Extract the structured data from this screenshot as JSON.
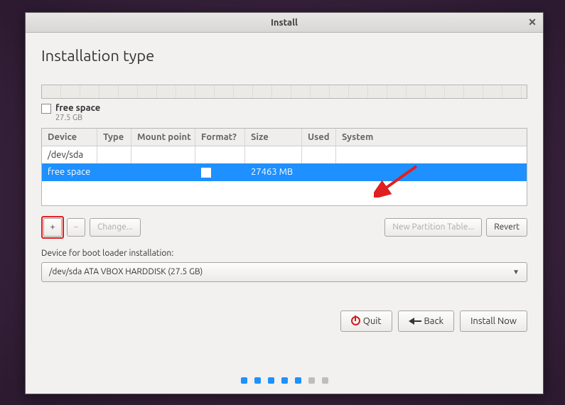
{
  "window": {
    "title": "Install"
  },
  "page": {
    "heading": "Installation type"
  },
  "summary": {
    "label": "free space",
    "size": "27.5 GB"
  },
  "table": {
    "headers": {
      "device": "Device",
      "type": "Type",
      "mount": "Mount point",
      "format": "Format?",
      "size": "Size",
      "used": "Used",
      "system": "System"
    },
    "rows": [
      {
        "device": "/dev/sda",
        "type": "",
        "mount": "",
        "format": "",
        "size": "",
        "used": "",
        "system": "",
        "selected": false,
        "parent": true
      },
      {
        "device": "  free space",
        "type": "",
        "mount": "",
        "format": "checkbox",
        "size": "27463 MB",
        "used": "",
        "system": "",
        "selected": true,
        "parent": false
      }
    ]
  },
  "toolbar": {
    "add": "+",
    "remove": "−",
    "change": "Change...",
    "newTable": "New Partition Table...",
    "revert": "Revert"
  },
  "boot": {
    "label": "Device for boot loader installation:",
    "value": "/dev/sda  ATA VBOX HARDDISK (27.5 GB)"
  },
  "footer": {
    "quit": "Quit",
    "back": "Back",
    "install": "Install Now"
  },
  "progress": {
    "total": 7,
    "active": 5
  }
}
